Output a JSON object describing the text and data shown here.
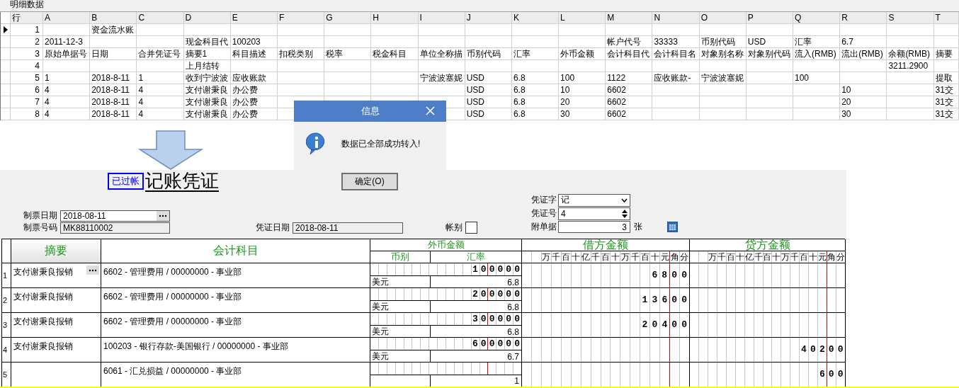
{
  "detail_panel": {
    "title": "明细数据",
    "row_header": "行",
    "columns": [
      "A",
      "B",
      "C",
      "D",
      "E",
      "F",
      "G",
      "H",
      "I",
      "J",
      "K",
      "L",
      "M",
      "N",
      "O",
      "P",
      "Q",
      "R",
      "S",
      "T"
    ],
    "rows": [
      {
        "selected": true,
        "no": "1",
        "cells": {
          "B": "资金流水账"
        }
      },
      {
        "selected": false,
        "no": "2",
        "cells": {
          "A": "2011-12-3",
          "D": "现金科目代",
          "E": "100203",
          "M": "帐户代号",
          "N": "33333",
          "O": "币别代码",
          "P": "USD",
          "Q": "汇率",
          "R": "6.7"
        }
      },
      {
        "selected": false,
        "no": "3",
        "cells": {
          "A": "原始单据号",
          "B": "日期",
          "C": "合并凭证号",
          "D": "摘要1",
          "E": "科目描述",
          "F": "扣税类别",
          "G": "税率",
          "H": "税金科目",
          "I": "单位全称描",
          "J": "币别代码",
          "K": "汇率",
          "L": "外币金额",
          "M": "会计科目代",
          "N": "会计科目名",
          "O": "对象别名称",
          "P": "对象别代码",
          "Q": "流入(RMB)",
          "R": "流出(RMB)",
          "S": "余额(RMB)",
          "T": "摘要"
        }
      },
      {
        "selected": false,
        "no": "4",
        "cells": {
          "D": "上月结转",
          "S": "3211.2900"
        }
      },
      {
        "selected": false,
        "no": "5",
        "cells": {
          "A": "1",
          "B": "2018-8-11",
          "C": "1",
          "D": "收到宁波波",
          "E": "应收账款",
          "I": "宁波波塞妮",
          "J": "USD",
          "K": "6.8",
          "L": "100",
          "M": "1122",
          "N": "应收账款-",
          "O": "宁波波塞妮",
          "Q": "100",
          "T": "提取"
        }
      },
      {
        "selected": false,
        "no": "6",
        "cells": {
          "A": "4",
          "B": "2018-8-11",
          "C": "4",
          "D": "支付谢秉良",
          "E": "办公费",
          "J": "USD",
          "K": "6.8",
          "L": "10",
          "M": "6602",
          "R": "10",
          "T": "31交"
        }
      },
      {
        "selected": false,
        "no": "7",
        "cells": {
          "A": "4",
          "B": "2018-8-11",
          "C": "4",
          "D": "支付谢秉良",
          "E": "办公费",
          "J": "USD",
          "K": "6.8",
          "L": "20",
          "M": "6602",
          "R": "20",
          "T": "31交"
        }
      },
      {
        "selected": false,
        "no": "8",
        "cells": {
          "A": "4",
          "B": "2018-8-11",
          "C": "4",
          "D": "支付谢秉良",
          "E": "办公费",
          "J": "USD",
          "K": "6.8",
          "L": "30",
          "M": "6602",
          "R": "30",
          "T": "31交"
        }
      }
    ]
  },
  "dialog": {
    "title": "信息",
    "message": "数据已全部成功转入!",
    "ok_button": "确定(O)"
  },
  "voucher": {
    "posted_badge": "已过帐",
    "title": "记账凭证",
    "fields": {
      "issue_date": {
        "label": "制票日期",
        "value": "2018-08-11"
      },
      "issue_no": {
        "label": "制票号码",
        "value": "MK88110002"
      },
      "voucher_date": {
        "label": "凭证日期",
        "value": "2018-08-11"
      },
      "ledger": {
        "label": "帐别",
        "checked": false
      },
      "voucher_word": {
        "label": "凭证字",
        "value": "记"
      },
      "voucher_no": {
        "label": "凭证号",
        "value": "4"
      },
      "attachments": {
        "label": "附单据",
        "value": "3",
        "unit": "张"
      }
    },
    "grid": {
      "columns": {
        "summary": "摘要",
        "account": "会计科目",
        "foreign": "外币金额",
        "currency": "币别",
        "rate": "汇率",
        "debit": "借方金额",
        "credit": "贷方金额"
      },
      "debit_units": [
        "万",
        "千",
        "百",
        "十",
        "亿",
        "千",
        "百",
        "十",
        "万",
        "千",
        "百",
        "十",
        "元",
        "角",
        "分"
      ],
      "credit_units": [
        "万",
        "千",
        "百",
        "十",
        "亿",
        "千",
        "百",
        "十",
        "万",
        "千",
        "百",
        "十",
        "元",
        "角",
        "分"
      ],
      "rows": [
        {
          "no": "1",
          "editing": true,
          "summary": "支付谢秉良报销",
          "account": "6602 - 管理费用 / 00000000 - 事业部",
          "foreign_amount": "100000",
          "currency": "美元",
          "rate": "6.8",
          "debit": "6800"
        },
        {
          "no": "2",
          "editing": false,
          "summary": "支付谢秉良报销",
          "account": "6602 - 管理费用 / 00000000 - 事业部",
          "foreign_amount": "200000",
          "currency": "美元",
          "rate": "6.8",
          "debit": "13600"
        },
        {
          "no": "3",
          "editing": false,
          "summary": "支付谢秉良报销",
          "account": "6602 - 管理费用 / 00000000 - 事业部",
          "foreign_amount": "300000",
          "currency": "美元",
          "rate": "6.8",
          "debit": "20400"
        },
        {
          "no": "4",
          "editing": false,
          "summary": "支付谢秉良报销",
          "account": "100203 - 银行存款-美国银行 / 00000000 - 事业部",
          "foreign_amount": "600000",
          "currency": "美元",
          "rate": "6.7",
          "credit": "40200"
        },
        {
          "no": "5",
          "editing": false,
          "account": "6061 - 汇兑损益 / 00000000 - 事业部",
          "rate": "1",
          "credit": "600"
        }
      ]
    }
  }
}
